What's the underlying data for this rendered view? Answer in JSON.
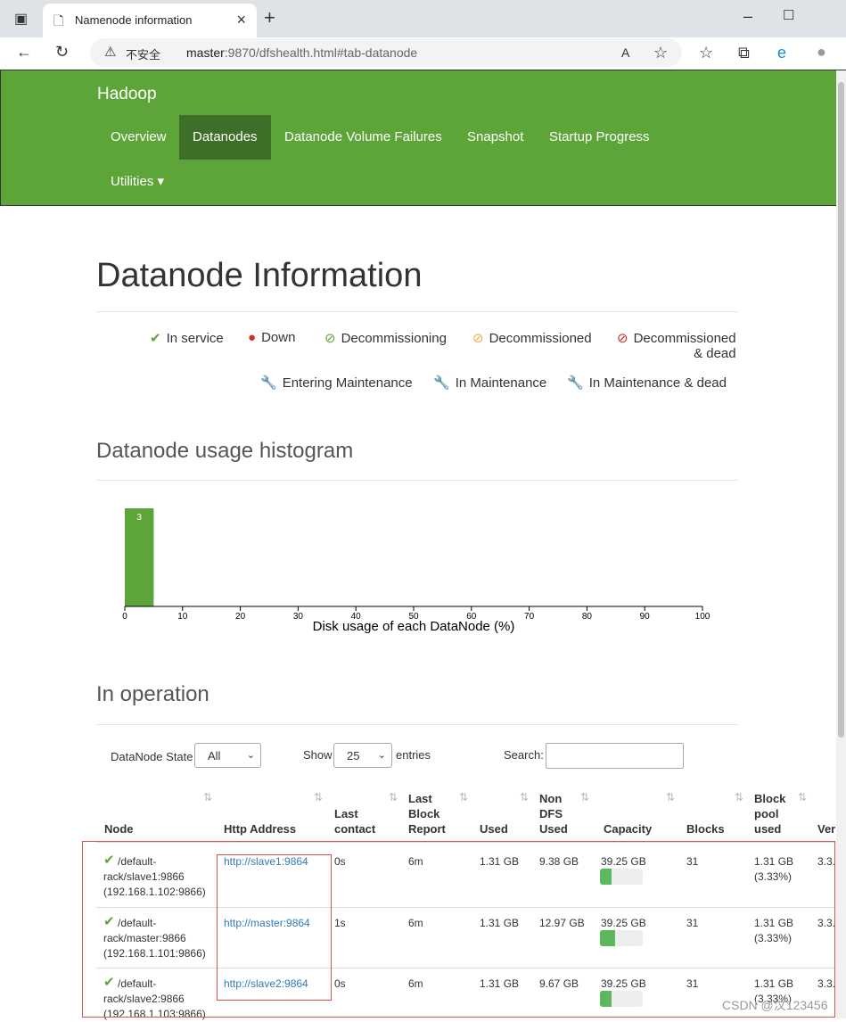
{
  "browser": {
    "tab_title": "Namenode information",
    "security": "不安全",
    "url_host": "master",
    "url_rest": ":9870/dfshealth.html#tab-datanode"
  },
  "navbar": {
    "brand": "Hadoop",
    "items": [
      {
        "label": "Overview"
      },
      {
        "label": "Datanodes"
      },
      {
        "label": "Datanode Volume Failures"
      },
      {
        "label": "Snapshot"
      },
      {
        "label": "Startup Progress"
      },
      {
        "label": "Utilities ▾"
      }
    ],
    "active": "Datanodes"
  },
  "page": {
    "title": "Datanode Information",
    "legend": [
      {
        "label": "In service",
        "icon": "check-icon",
        "color": "#5ea539"
      },
      {
        "label": "Down",
        "icon": "exclamation-icon",
        "color": "#c9302c"
      },
      {
        "label": "Decommissioning",
        "icon": "ban-icon",
        "color": "#5ea539"
      },
      {
        "label": "Decommissioned",
        "icon": "ban-icon",
        "color": "#f0ad4e"
      },
      {
        "label": "Decommissioned",
        "label2": "& dead",
        "icon": "ban-icon",
        "color": "#c9302c"
      },
      {
        "label": "Entering Maintenance",
        "icon": "wrench-icon",
        "color": "#5ea539"
      },
      {
        "label": "In Maintenance",
        "icon": "wrench-icon",
        "color": "#f0ad4e"
      },
      {
        "label": "In Maintenance & dead",
        "icon": "wrench-icon",
        "color": "#c9302c"
      }
    ],
    "histogram_title": "Datanode usage histogram",
    "operation_title": "In operation"
  },
  "chart_data": {
    "type": "bar",
    "xlabel": "Disk usage of each DataNode (%)",
    "xlim": [
      0,
      100
    ],
    "xticks": [
      "0",
      "10",
      "20",
      "30",
      "40",
      "50",
      "60",
      "70",
      "80",
      "90",
      "100"
    ],
    "bins": [
      {
        "x0": 0,
        "x1": 5,
        "value": 3
      }
    ],
    "color": "#5ea539"
  },
  "controls": {
    "state_label": "DataNode State",
    "state_value": "All",
    "show_label": "Show",
    "show_value": "25",
    "entries_label": "entries",
    "search_label": "Search:"
  },
  "table": {
    "headers": [
      "Node",
      "Http Address",
      "Last\ncontact",
      "Last\nBlock\nReport",
      "Used",
      "Non\nDFS\nUsed",
      "Capacity",
      "Blocks",
      "Block\npool\nused",
      "Ver"
    ],
    "rows": [
      {
        "node": [
          "/default-",
          "rack/slave1:9866",
          "(192.168.1.102:9866)"
        ],
        "http": "http://slave1:9864",
        "last_contact": "0s",
        "last_block": "6m",
        "used": "1.31 GB",
        "non_dfs": "9.38 GB",
        "capacity": "39.25 GB",
        "cap_fraction": 0.27,
        "blocks": "31",
        "bp_used": [
          "1.31 GB",
          "(3.33%)"
        ],
        "ver": "3.3."
      },
      {
        "node": [
          "/default-",
          "rack/master:9866",
          "(192.168.1.101:9866)"
        ],
        "http": "http://master:9864",
        "last_contact": "1s",
        "last_block": "6m",
        "used": "1.31 GB",
        "non_dfs": "12.97 GB",
        "capacity": "39.25 GB",
        "cap_fraction": 0.36,
        "blocks": "31",
        "bp_used": [
          "1.31 GB",
          "(3.33%)"
        ],
        "ver": "3.3."
      },
      {
        "node": [
          "/default-",
          "rack/slave2:9866",
          "(192.168.1.103:9866)"
        ],
        "http": "http://slave2:9864",
        "last_contact": "0s",
        "last_block": "6m",
        "used": "1.31 GB",
        "non_dfs": "9.67 GB",
        "capacity": "39.25 GB",
        "cap_fraction": 0.28,
        "blocks": "31",
        "bp_used": [
          "1.31 GB",
          "(3.33%)"
        ],
        "ver": "3.3."
      }
    ]
  },
  "watermark": "CSDN @汶123456"
}
